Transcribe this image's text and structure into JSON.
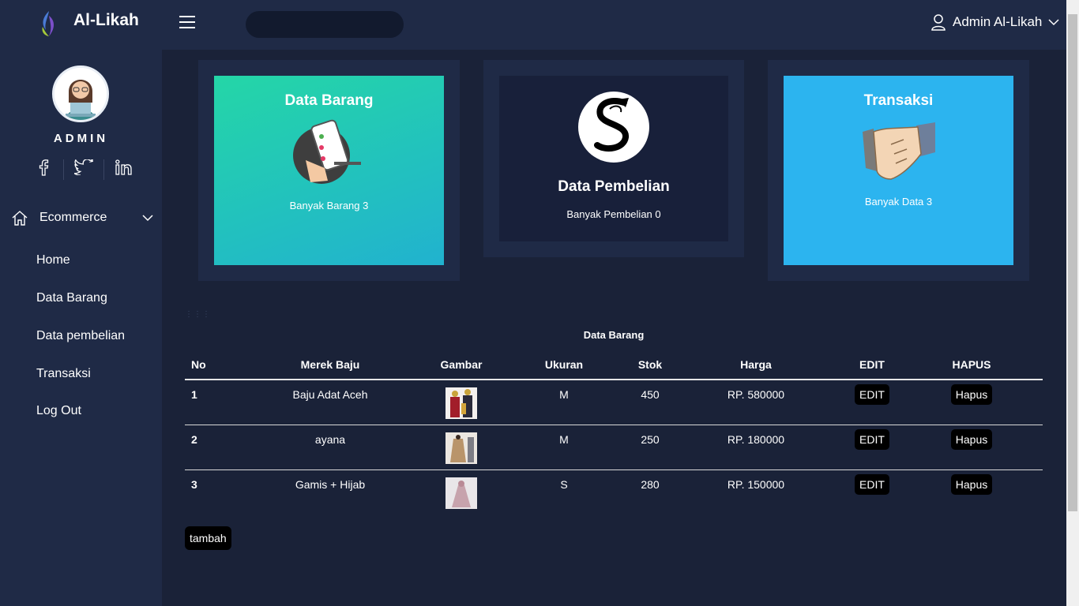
{
  "header": {
    "brand": "Al-Likah",
    "user_name": "Admin Al-Likah",
    "search_placeholder": ""
  },
  "sidebar": {
    "role": "ADMIN",
    "menu_group": "Ecommerce",
    "items": [
      {
        "label": "Home"
      },
      {
        "label": "Data Barang"
      },
      {
        "label": "Data pembelian"
      },
      {
        "label": "Transaksi"
      },
      {
        "label": "Log Out"
      }
    ],
    "socials": [
      "facebook-icon",
      "twitter-icon",
      "linkedin-icon"
    ]
  },
  "cards": [
    {
      "title": "Data Barang",
      "subtitle": "Banyak Barang 3",
      "color": "#22c9a9"
    },
    {
      "title": "Data Pembelian",
      "subtitle": "Banyak Pembelian 0",
      "color": "#18203a"
    },
    {
      "title": "Transaksi",
      "subtitle": "Banyak Data 3",
      "color": "#2cb4ef"
    }
  ],
  "table": {
    "title": "Data Barang",
    "headers": [
      "No",
      "Merek Baju",
      "Gambar",
      "Ukuran",
      "Stok",
      "Harga",
      "EDIT",
      "HAPUS"
    ],
    "rows": [
      {
        "no": "1",
        "merek": "Baju Adat Aceh",
        "ukuran": "M",
        "stok": "450",
        "harga": "RP. 580000",
        "edit": "EDIT",
        "hapus": "Hapus"
      },
      {
        "no": "2",
        "merek": "ayana",
        "ukuran": "M",
        "stok": "250",
        "harga": "RP. 180000",
        "edit": "EDIT",
        "hapus": "Hapus"
      },
      {
        "no": "3",
        "merek": "Gamis + Hijab",
        "ukuran": "S",
        "stok": "280",
        "harga": "RP. 150000",
        "edit": "EDIT",
        "hapus": "Hapus"
      }
    ],
    "add_label": "tambah"
  }
}
